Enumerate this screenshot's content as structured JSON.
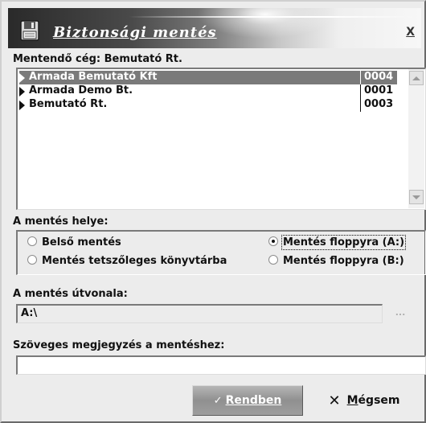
{
  "window": {
    "title": "Biztonsági mentés",
    "close_label": "X"
  },
  "company": {
    "label": "Mentendő cég: Bemutató Rt."
  },
  "company_list": {
    "rows": [
      {
        "name": "Armada Bemutató Kft",
        "code": "0004",
        "selected": true
      },
      {
        "name": "Armada Demo Bt.",
        "code": "0001",
        "selected": false
      },
      {
        "name": "Bemutató Rt.",
        "code": "0003",
        "selected": false
      }
    ]
  },
  "location": {
    "label": "A mentés helye:",
    "options": [
      {
        "label": "Belső mentés",
        "checked": false
      },
      {
        "label": "Mentés floppyra (A:)",
        "checked": true
      },
      {
        "label": "Mentés tetszőleges könyvtárba",
        "checked": false
      },
      {
        "label": "Mentés floppyra (B:)",
        "checked": false
      }
    ]
  },
  "path": {
    "label": "A mentés útvonala:",
    "value": "A:\\",
    "browse_label": "..."
  },
  "note": {
    "label": "Szöveges megjegyzés a mentéshez:",
    "value": ""
  },
  "buttons": {
    "ok_check": "✓",
    "ok_label": "Rendben",
    "cancel_x": "✕",
    "cancel_first": "M",
    "cancel_rest": "égsem"
  },
  "colors": {
    "selection": "#7a7a7a",
    "ok_button": "#9e9e9e",
    "window_bg": "#ececec"
  },
  "icons": {
    "title": "backup-disk-icon",
    "row_marker": "triangle-right-icon",
    "scroll_up": "triangle-up-icon",
    "scroll_down": "triangle-down-icon"
  }
}
